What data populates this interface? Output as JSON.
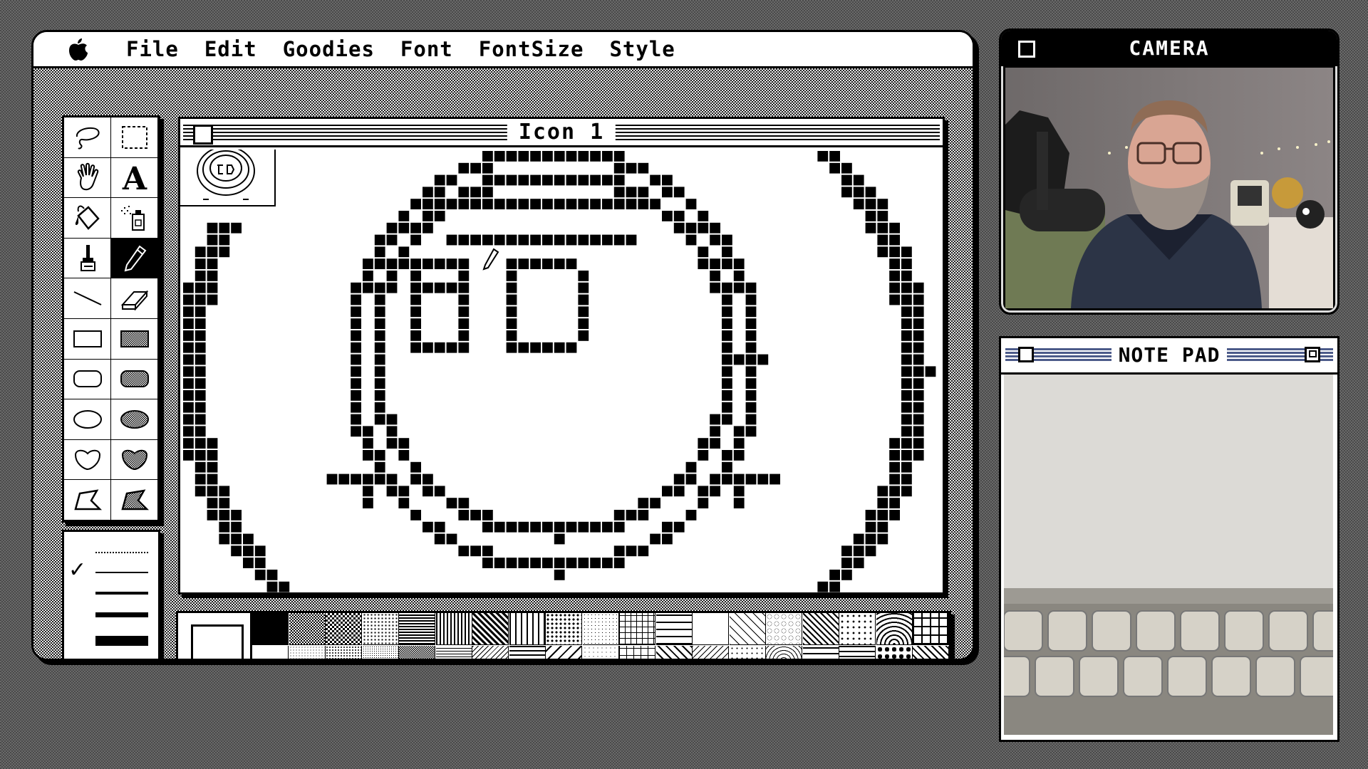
{
  "macpaint": {
    "menu": {
      "apple": "apple-menu-icon",
      "items": [
        "File",
        "Edit",
        "Goodies",
        "Font",
        "FontSize",
        "Style"
      ]
    },
    "tools": [
      "lasso-icon",
      "marquee-icon",
      "hand-icon",
      "text-tool-icon",
      "paint-bucket-icon",
      "spray-can-icon",
      "paintbrush-icon",
      "pencil-icon",
      "line-tool-icon",
      "eraser-icon",
      "rectangle-icon",
      "filled-rectangle-icon",
      "rounded-rectangle-icon",
      "filled-rounded-rectangle-icon",
      "oval-icon",
      "filled-oval-icon",
      "freeform-shape-icon",
      "filled-freeform-shape-icon",
      "polygon-icon",
      "filled-polygon-icon"
    ],
    "active_tool": "pencil-icon",
    "line_widths": {
      "count": 5,
      "selected": 2,
      "check": "✓"
    },
    "document": {
      "title": "Icon 1"
    },
    "patterns": {
      "count": 38
    }
  },
  "camera": {
    "title": "CAMERA"
  },
  "notepad": {
    "title": "NOTE PAD"
  },
  "colors": {
    "desktop": "#5a5a5a",
    "notepad_stripes": "#4c5b8a"
  }
}
